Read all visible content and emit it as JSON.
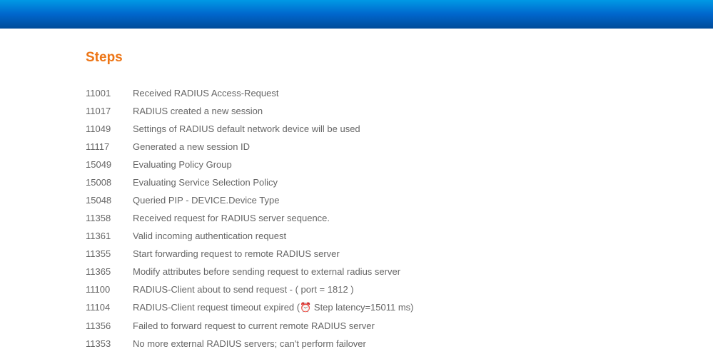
{
  "title": "Steps",
  "steps": [
    {
      "code": "11001",
      "desc": "Received RADIUS Access-Request"
    },
    {
      "code": "11017",
      "desc": "RADIUS created a new session"
    },
    {
      "code": "11049",
      "desc": "Settings of RADIUS default network device will be used"
    },
    {
      "code": "11117",
      "desc": "Generated a new session ID"
    },
    {
      "code": "15049",
      "desc": "Evaluating Policy Group"
    },
    {
      "code": "15008",
      "desc": "Evaluating Service Selection Policy"
    },
    {
      "code": "15048",
      "desc": "Queried PIP - DEVICE.Device Type"
    },
    {
      "code": "11358",
      "desc": "Received request for RADIUS server sequence."
    },
    {
      "code": "11361",
      "desc": "Valid incoming authentication request"
    },
    {
      "code": "11355",
      "desc": "Start forwarding request to remote RADIUS server"
    },
    {
      "code": "11365",
      "desc": "Modify attributes before sending request to external radius server"
    },
    {
      "code": "11100",
      "desc": "RADIUS-Client about to send request - ( port = 1812 )"
    },
    {
      "code": "11104",
      "desc_pre": "RADIUS-Client request timeout expired (",
      "icon": "⏰",
      "desc_post": " Step latency=15011 ms)"
    },
    {
      "code": "11356",
      "desc": "Failed to forward request to current remote RADIUS server"
    },
    {
      "code": "11353",
      "desc": "No more external RADIUS servers; can't perform failover"
    }
  ]
}
